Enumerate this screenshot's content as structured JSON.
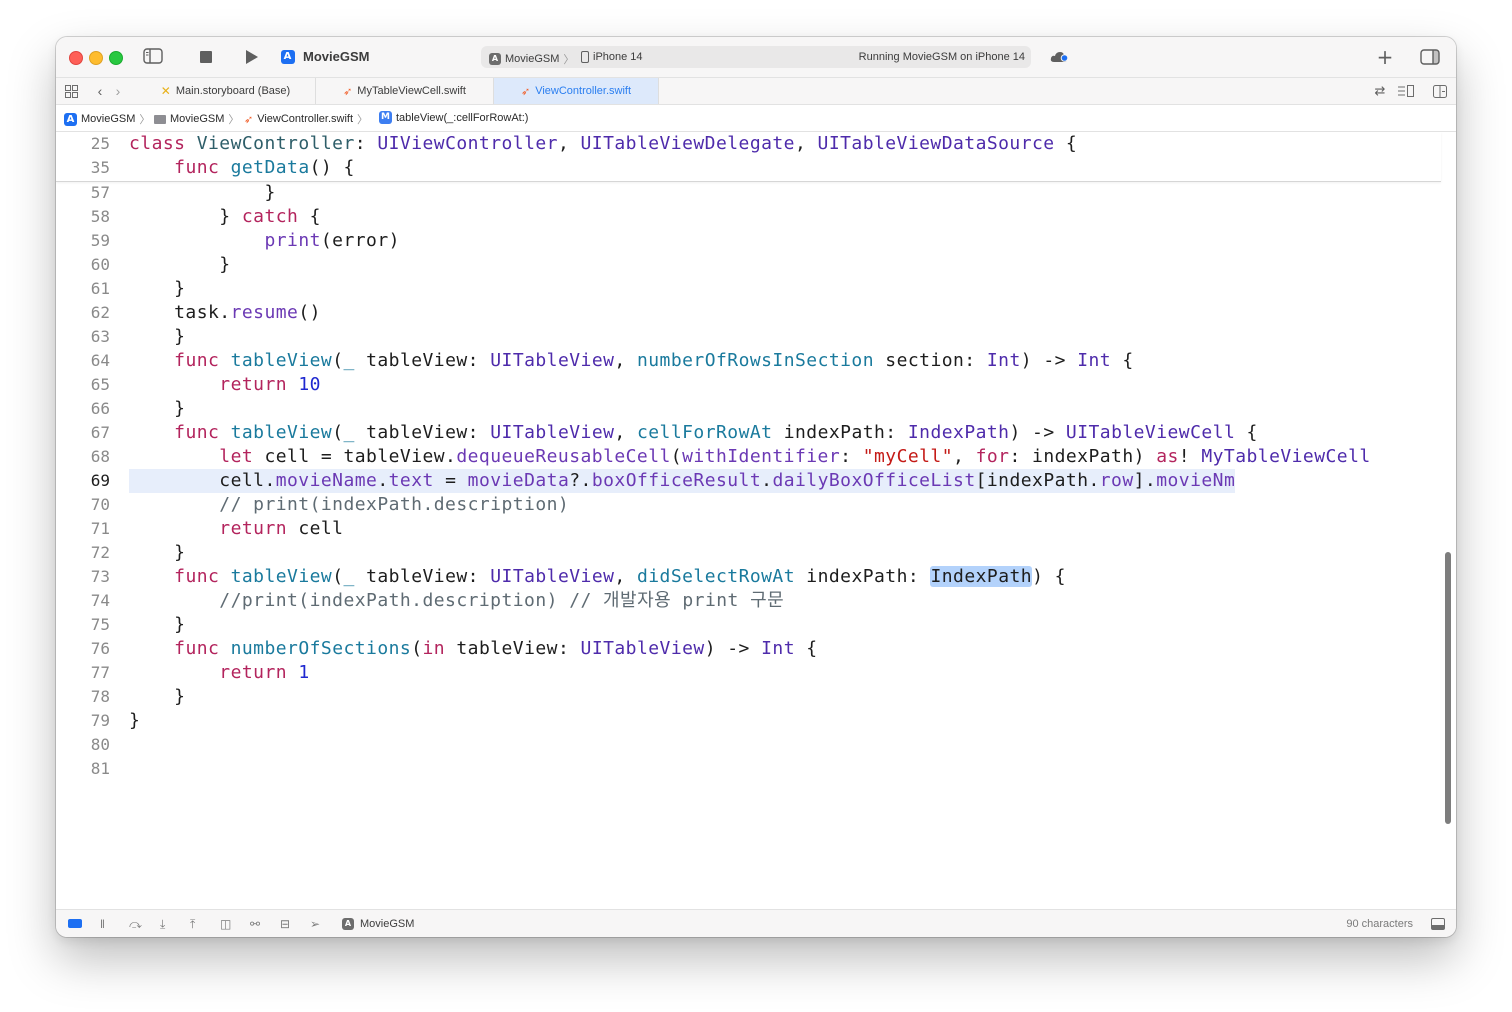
{
  "toolbar": {
    "scheme_title": "MovieGSM",
    "status_scheme": "MovieGSM",
    "status_device": "iPhone 14",
    "status_text": "Running MovieGSM on iPhone 14"
  },
  "tabs": [
    {
      "label": "Main.storyboard (Base)",
      "active": false
    },
    {
      "label": "MyTableViewCell.swift",
      "active": false
    },
    {
      "label": "ViewController.swift",
      "active": true
    }
  ],
  "jumpbar": {
    "project": "MovieGSM",
    "group": "MovieGSM",
    "file": "ViewController.swift",
    "symbol": "tableView(_:cellForRowAt:)"
  },
  "editor": {
    "current_line": 69,
    "lines": [
      {
        "num": "25",
        "text": "class ViewController: UIViewController, UITableViewDelegate, UITableViewDataSource {"
      },
      {
        "num": "35",
        "text": "    func getData() {"
      },
      {
        "num": "57",
        "text": "            }"
      },
      {
        "num": "58",
        "text": "        } catch {"
      },
      {
        "num": "59",
        "text": "            print(error)"
      },
      {
        "num": "60",
        "text": "        }"
      },
      {
        "num": "61",
        "text": "    }"
      },
      {
        "num": "62",
        "text": "    task.resume()"
      },
      {
        "num": "63",
        "text": "    }"
      },
      {
        "num": "64",
        "text": "    func tableView(_ tableView: UITableView, numberOfRowsInSection section: Int) -> Int {"
      },
      {
        "num": "65",
        "text": "        return 10"
      },
      {
        "num": "66",
        "text": "    }"
      },
      {
        "num": "67",
        "text": "    func tableView(_ tableView: UITableView, cellForRowAt indexPath: IndexPath) -> UITableViewCell {"
      },
      {
        "num": "68",
        "text": "        let cell = tableView.dequeueReusableCell(withIdentifier: \"myCell\", for: indexPath) as! MyTableViewCell"
      },
      {
        "num": "69",
        "text": "        cell.movieName.text = movieData?.boxOfficeResult.dailyBoxOfficeList[indexPath.row].movieNm"
      },
      {
        "num": "70",
        "text": "        // print(indexPath.description)"
      },
      {
        "num": "71",
        "text": "        return cell"
      },
      {
        "num": "72",
        "text": "    }"
      },
      {
        "num": "73",
        "text": "    func tableView(_ tableView: UITableView, didSelectRowAt indexPath: IndexPath) {"
      },
      {
        "num": "74",
        "text": "        //print(indexPath.description) // 개발자용 print 구문"
      },
      {
        "num": "75",
        "text": "    }"
      },
      {
        "num": "76",
        "text": "    func numberOfSections(in tableView: UITableView) -> Int {"
      },
      {
        "num": "77",
        "text": "        return 1"
      },
      {
        "num": "78",
        "text": "    }"
      },
      {
        "num": "79",
        "text": "}"
      },
      {
        "num": "80",
        "text": ""
      },
      {
        "num": "81",
        "text": ""
      }
    ]
  },
  "statusbar": {
    "scheme": "MovieGSM",
    "characters": "90 characters"
  },
  "icons": {
    "sidebar_toggle": "sidebar-left-icon",
    "stop": "stop-icon",
    "run": "play-icon",
    "add": "plus-icon",
    "inspector_toggle": "sidebar-right-icon",
    "cloud": "cloud-icon"
  },
  "colors": {
    "keyword": "#b3245d",
    "type": "#4e2bab",
    "function": "#1a7a9d",
    "number": "#1f28d0",
    "string": "#c41a16",
    "comment": "#5f6b73",
    "active_tab": "#2a7ef0"
  }
}
